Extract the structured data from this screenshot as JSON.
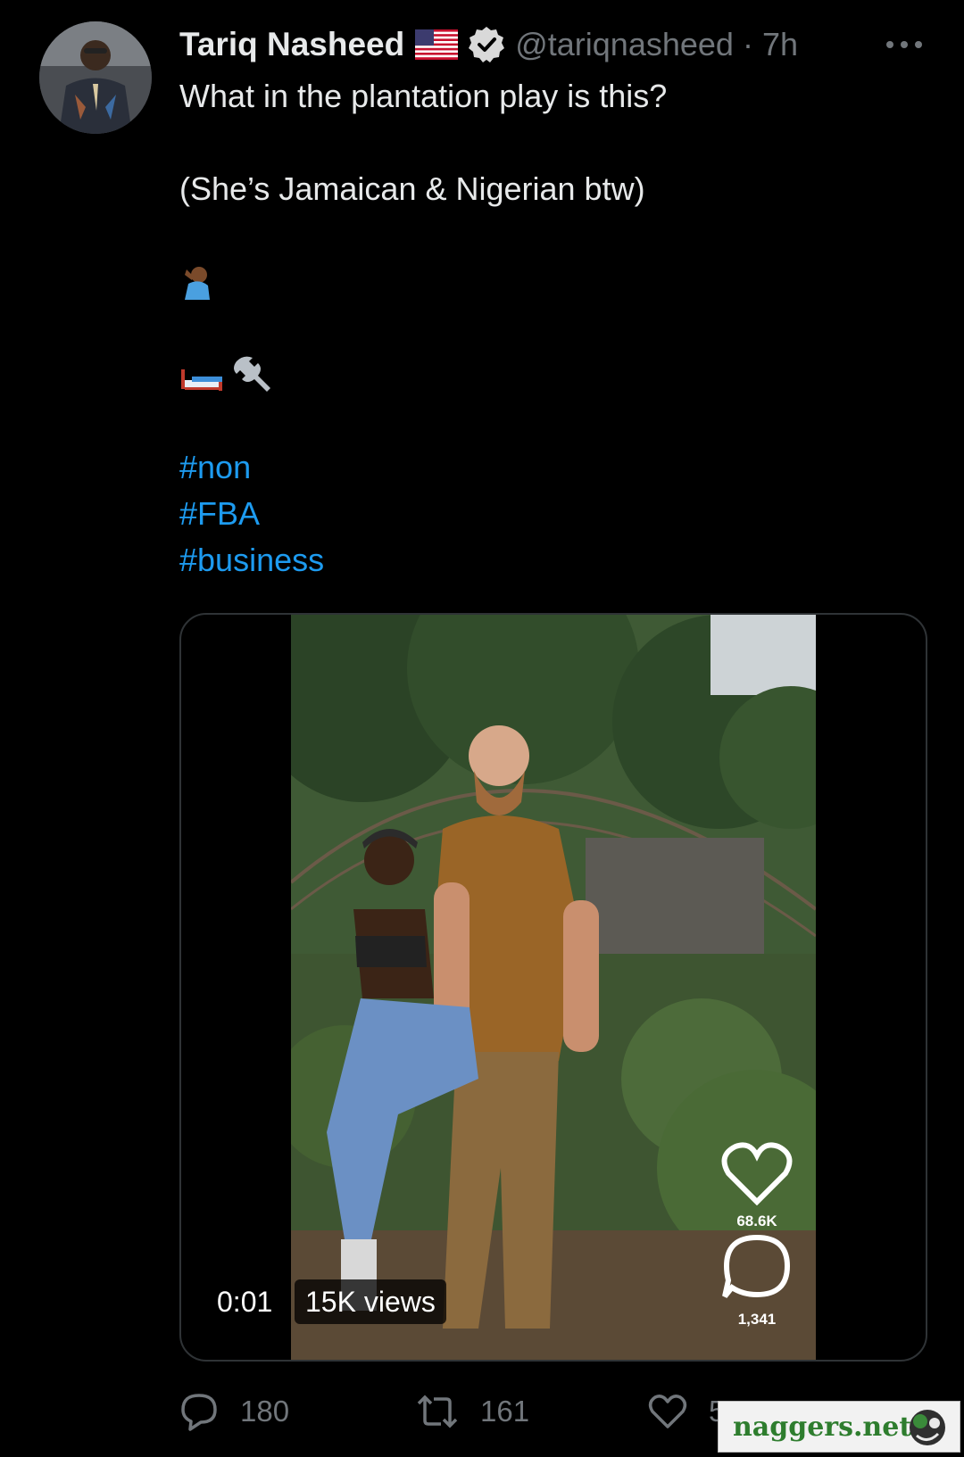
{
  "tweet": {
    "display_name": "Tariq Nasheed",
    "handle": "@tariqnasheed",
    "separator": "·",
    "time": "7h",
    "text_line_1": "What in the plantation play is this?",
    "text_line_2": "(She’s Jamaican & Nigerian btw)",
    "emoji_1": "facepalm-emoji",
    "emoji_2": "bed-emoji",
    "emoji_3": "wrench-emoji",
    "hashtags": [
      "#non",
      "#FBA",
      "#business"
    ]
  },
  "media": {
    "timestamp": "0:01",
    "views": "15K views",
    "likes_overlay": "68.6K",
    "comments_overlay": "1,341"
  },
  "actions": {
    "replies": "180",
    "retweets": "161",
    "likes": "541"
  },
  "watermark": {
    "text": "naggers.net"
  },
  "colors": {
    "background": "#000000",
    "text": "#e7e9ea",
    "muted": "#71767b",
    "link": "#1d9bf0",
    "border": "#2f3336"
  },
  "icons": {
    "flag": "us-flag-icon",
    "verified": "verified-badge-icon",
    "more": "more-icon",
    "reply": "reply-icon",
    "retweet": "retweet-icon",
    "like": "like-icon"
  }
}
